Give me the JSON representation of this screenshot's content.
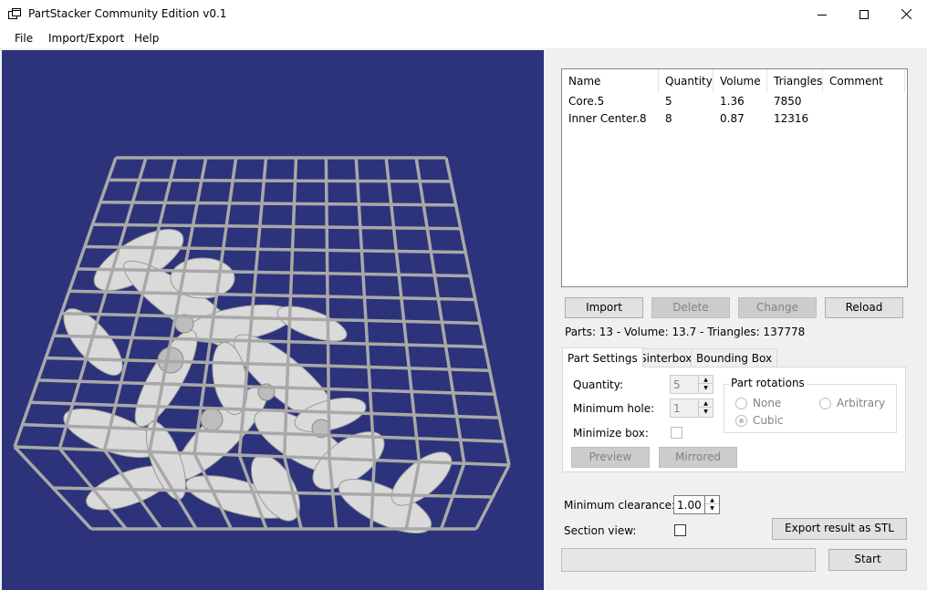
{
  "window": {
    "title": "PartStacker Community Edition v0.1"
  },
  "menu": {
    "items": [
      "File",
      "Import/Export",
      "Help"
    ]
  },
  "parts_table": {
    "columns": [
      "Name",
      "Quantity",
      "Volume",
      "Triangles",
      "Comment"
    ],
    "rows": [
      {
        "name": "Core.5",
        "quantity": "5",
        "volume": "1.36",
        "triangles": "7850",
        "comment": ""
      },
      {
        "name": "Inner Center.8",
        "quantity": "8",
        "volume": "0.87",
        "triangles": "12316",
        "comment": ""
      }
    ]
  },
  "table_buttons": {
    "import": "Import",
    "delete": "Delete",
    "change": "Change",
    "reload": "Reload"
  },
  "parts_info": "Parts: 13 - Volume: 13.7 - Triangles: 137778",
  "tabs": [
    "Part Settings",
    "Sinterbox",
    "Bounding Box"
  ],
  "part_settings": {
    "quantity_label": "Quantity:",
    "quantity_value": "5",
    "min_hole_label": "Minimum hole:",
    "min_hole_value": "1",
    "minimize_box_label": "Minimize box:",
    "rotations_title": "Part rotations",
    "rotation_none": "None",
    "rotation_arbitrary": "Arbitrary",
    "rotation_cubic": "Cubic",
    "preview_button": "Preview",
    "mirrored_button": "Mirrored"
  },
  "bottom": {
    "min_clearance_label": "Minimum clearance:",
    "min_clearance_value": "1.00",
    "section_view_label": "Section view:",
    "export_button": "Export result as STL",
    "start_button": "Start"
  },
  "colors": {
    "viewport_bg": "#2c337b",
    "cage": "#a8a8a8",
    "parts": "#dadada"
  },
  "icons": {
    "app": "app-window-icon",
    "minimize": "minimize-icon",
    "maximize": "maximize-icon",
    "close": "close-icon"
  }
}
